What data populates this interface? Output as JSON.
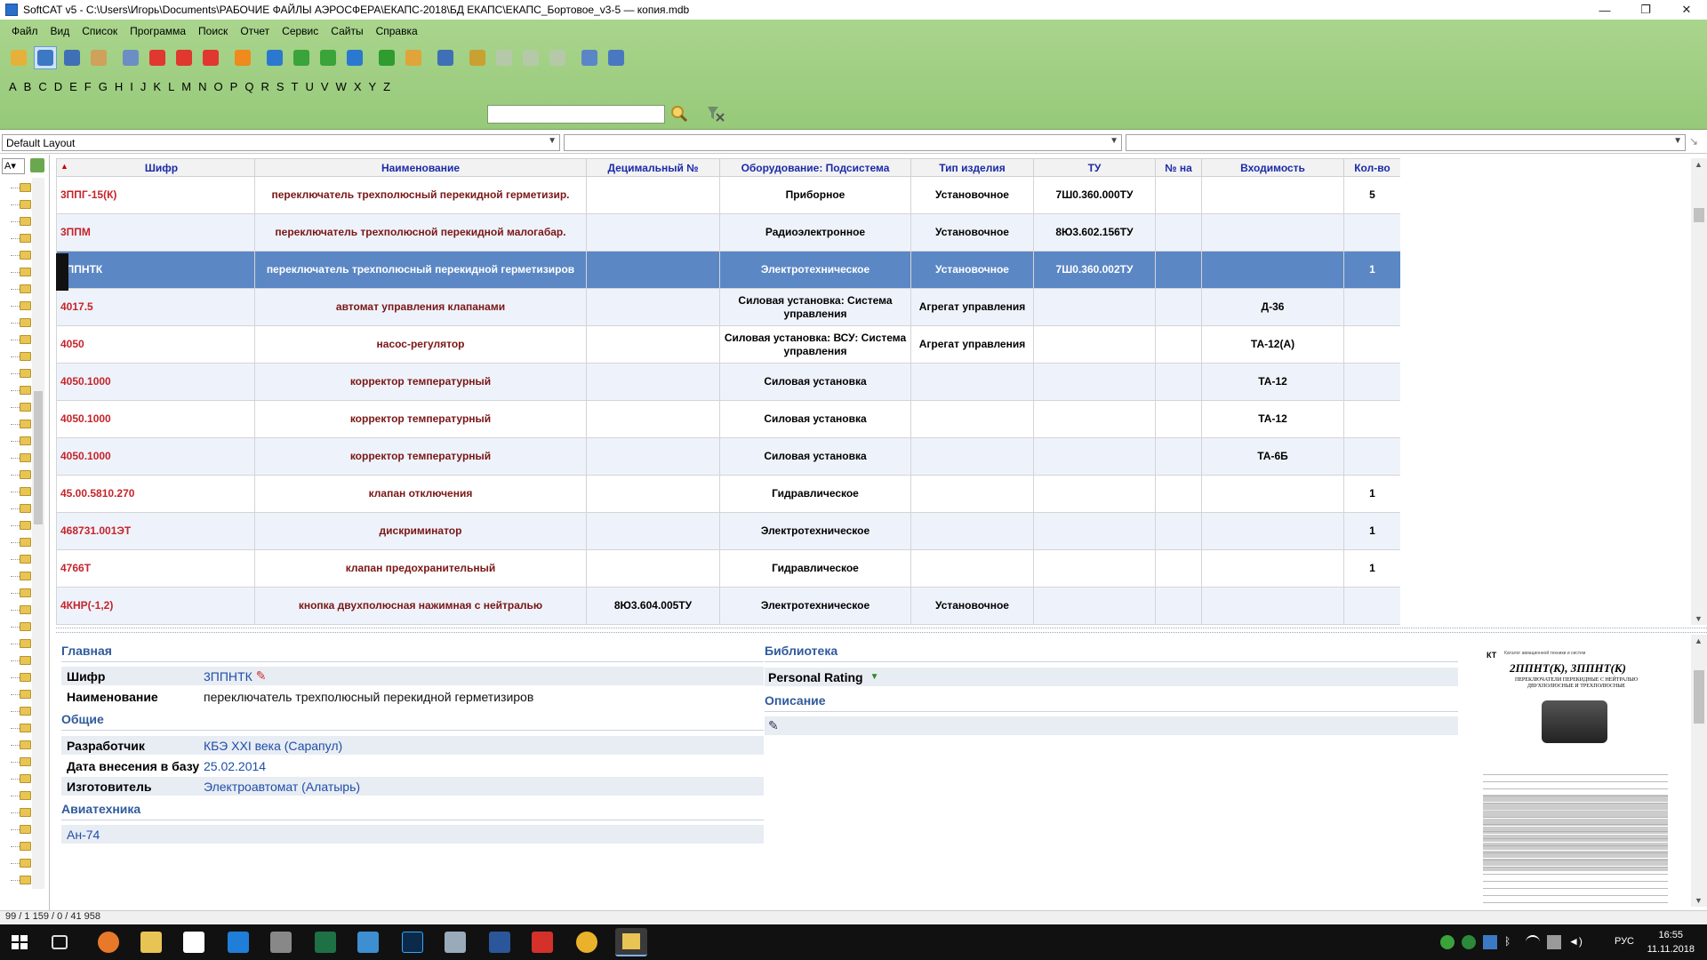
{
  "window": {
    "title": "SoftCAT v5 - C:\\Users\\Игорь\\Documents\\РАБОЧИЕ ФАЙЛЫ АЭРОСФЕРА\\ЕКАПС-2018\\БД ЕКАПС\\ЕКАПС_Бортовое_v3-5 — копия.mdb",
    "minimize": "—",
    "maximize": "❐",
    "close": "✕"
  },
  "menu": [
    "Файл",
    "Вид",
    "Список",
    "Программа",
    "Поиск",
    "Отчет",
    "Сервис",
    "Сайты",
    "Справка"
  ],
  "toolbar_icons": [
    "home-icon",
    "database-icon",
    "grid-icon",
    "tools-icon",
    "preview-icon",
    "add-icon",
    "move-up-icon",
    "delete-icon",
    "refresh-icon",
    "first-record-icon",
    "prev-record-icon",
    "next-record-icon",
    "last-record-icon",
    "check-icon",
    "edit-form-icon",
    "columns-icon",
    "key-icon",
    "back-arrow-icon",
    "forward-arrow-icon",
    "windows-icon",
    "export-icon",
    "chart-icon"
  ],
  "alphabet": [
    "A",
    "B",
    "C",
    "D",
    "E",
    "F",
    "G",
    "H",
    "I",
    "J",
    "K",
    "L",
    "M",
    "N",
    "O",
    "P",
    "Q",
    "R",
    "S",
    "T",
    "U",
    "V",
    "W",
    "X",
    "Y",
    "Z"
  ],
  "search": {
    "value": ""
  },
  "layout": {
    "selected": "Default Layout",
    "combo2": "",
    "combo3": ""
  },
  "left_panel": {
    "combo": "А"
  },
  "grid": {
    "columns": [
      "Шифр",
      "Наименование",
      "Децимальный №",
      "Оборудование: Подсистема",
      "Тип изделия",
      "ТУ",
      "№ на",
      "Входимость",
      "Кол-во"
    ],
    "rows": [
      [
        "3ППГ-15(К)",
        "переключатель трехполюсный перекидной герметизир.",
        "",
        "Приборное",
        "Установочное",
        "7Ш0.360.000ТУ",
        "",
        "",
        "5"
      ],
      [
        "3ППМ",
        "переключатель трехполюсной перекидной малогабар.",
        "",
        "Радиоэлектронное",
        "Установочное",
        "8Ю3.602.156ТУ",
        "",
        "",
        ""
      ],
      [
        "3ППНТК",
        "переключатель трехполюсный перекидной герметизиров",
        "",
        "Электротехническое",
        "Установочное",
        "7Ш0.360.002ТУ",
        "",
        "",
        "1"
      ],
      [
        "4017.5",
        "автомат управления клапанами",
        "",
        "Силовая установка: Система управления",
        "Агрегат управления",
        "",
        "",
        "Д-36",
        ""
      ],
      [
        "4050",
        "насос-регулятор",
        "",
        "Силовая установка: ВСУ: Система управления",
        "Агрегат управления",
        "",
        "",
        "ТА-12(А)",
        ""
      ],
      [
        "4050.1000",
        "корректор температурный",
        "",
        "Силовая установка",
        "",
        "",
        "",
        "ТА-12",
        ""
      ],
      [
        "4050.1000",
        "корректор температурный",
        "",
        "Силовая установка",
        "",
        "",
        "",
        "ТА-12",
        ""
      ],
      [
        "4050.1000",
        "корректор температурный",
        "",
        "Силовая установка",
        "",
        "",
        "",
        "ТА-6Б",
        ""
      ],
      [
        "45.00.5810.270",
        "клапан отключения",
        "",
        "Гидравлическое",
        "",
        "",
        "",
        "",
        "1"
      ],
      [
        "468731.001ЭТ",
        "дискриминатор",
        "",
        "Электротехническое",
        "",
        "",
        "",
        "",
        "1"
      ],
      [
        "4766Т",
        "клапан предохранительный",
        "",
        "Гидравлическое",
        "",
        "",
        "",
        "",
        "1"
      ],
      [
        "4КНР(-1,2)",
        "кнопка двухполюсная нажимная с нейтралью",
        "8Ю3.604.005ТУ",
        "Электротехническое",
        "Установочное",
        "",
        "",
        "",
        ""
      ]
    ],
    "selected_row": 2
  },
  "detail": {
    "main_title": "Главная",
    "shifr_label": "Шифр",
    "shifr_value": "3ППНТК",
    "name_label": "Наименование",
    "name_value": "переключатель трехполюсный перекидной герметизиров",
    "general_title": "Общие",
    "developer_label": "Разработчик",
    "developer_value": "КБЭ XXI века (Сарапул)",
    "date_label": "Дата внесения в базу",
    "date_value": "25.02.2014",
    "maker_label": "Изготовитель",
    "maker_value": "Электроавтомат (Алатырь)",
    "avia_title": "Авиатехника",
    "avia_value": "Ан-74",
    "library_title": "Библиотека",
    "rating_label": "Personal Rating",
    "description_title": "Описание"
  },
  "datasheet": {
    "logo": "КТ",
    "header": "Каталог авиационной техники и систем",
    "title": "2ППНТ(К), 3ППНТ(К)",
    "subtitle": "ПЕРЕКЛЮЧАТЕЛИ ПЕРЕКИДНЫЕ С НЕЙТРАЛЬЮ ДВУХПОЛЮСНЫЕ И ТРЕХПОЛЮСНЫЕ"
  },
  "status": {
    "text": "99 / 1 159 / 0 / 41 958"
  },
  "taskbar": {
    "lang": "РУС",
    "time": "16:55",
    "date": "11.11.2018",
    "apps": [
      "windows-start-icon",
      "task-view-icon",
      "firefox-icon",
      "explorer-icon",
      "store-icon",
      "edge-icon",
      "app-icon",
      "excel-icon",
      "app2-icon",
      "photoshop-icon",
      "app3-icon",
      "word-icon",
      "acrobat-icon",
      "chrome-icon",
      "softcat-icon"
    ]
  },
  "colors": {
    "toolbar_green": "#a9d58c",
    "selection": "#5b87c5",
    "code_red": "#c6242a",
    "header_blue": "#1b2aa8",
    "section_blue": "#2f5a9c"
  }
}
